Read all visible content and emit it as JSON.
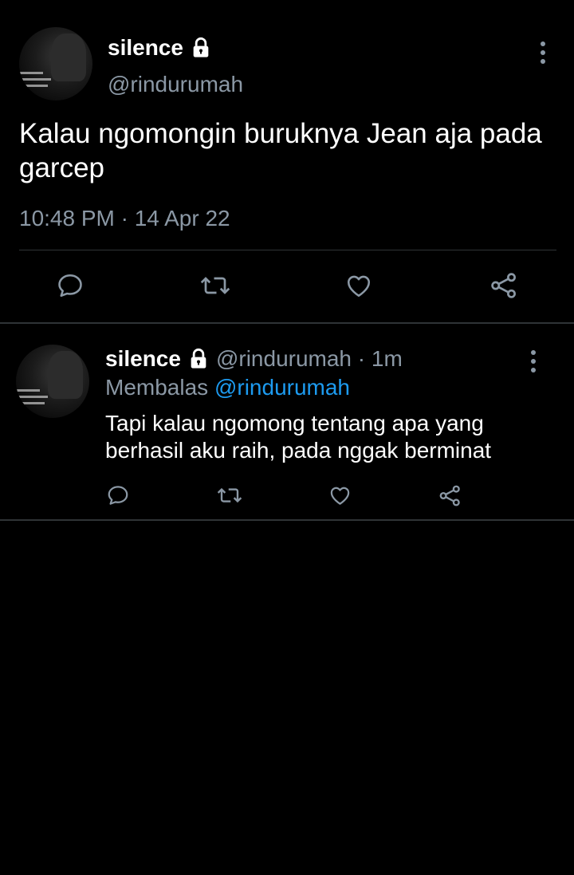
{
  "colors": {
    "background": "#000000",
    "primary_text": "#ffffff",
    "secondary_text": "#8b98a5",
    "link": "#1d9bf0",
    "divider": "#2f3336"
  },
  "main_tweet": {
    "avatar_icon": "avatar",
    "display_name": "silence",
    "locked_icon": "lock-icon",
    "handle": "@rindurumah",
    "text": "Kalau ngomongin buruknya Jean aja pada garcep",
    "timestamp": "10:48 PM · 14 Apr 22",
    "actions": [
      "reply-icon",
      "retweet-icon",
      "like-icon",
      "share-icon"
    ]
  },
  "reply_tweet": {
    "avatar_icon": "avatar",
    "display_name": "silence",
    "locked_icon": "lock-icon",
    "meta": "@rindurumah · 1m",
    "replying_label": "Membalas",
    "replying_to": "@rindurumah",
    "text": "Tapi kalau ngomong tentang apa yang berhasil aku raih, pada nggak berminat",
    "actions": [
      "reply-icon",
      "retweet-icon",
      "like-icon",
      "share-icon"
    ]
  }
}
